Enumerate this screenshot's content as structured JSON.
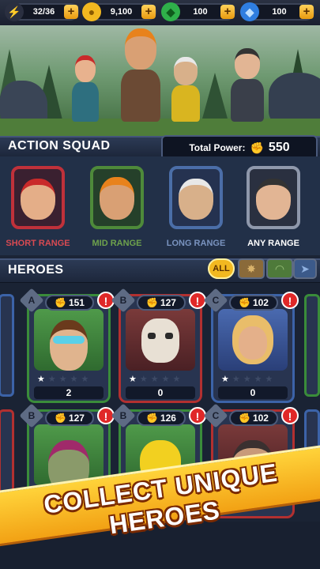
{
  "resources": [
    {
      "name": "energy",
      "value": "32/36",
      "icon": "lightning-icon",
      "color": "#f2c230"
    },
    {
      "name": "coins",
      "value": "9,100",
      "icon": "coin-icon",
      "color": "#f2b820"
    },
    {
      "name": "gems-green",
      "value": "100",
      "icon": "green-gem-icon",
      "color": "#2fb04a"
    },
    {
      "name": "diamonds",
      "value": "100",
      "icon": "blue-diamond-icon",
      "color": "#2f7ee0"
    }
  ],
  "squad": {
    "title": "ACTION SQUAD",
    "total_power_label": "Total Power:",
    "total_power_value": "550",
    "slots": [
      {
        "range": "SHORT RANGE",
        "color": "#c0313a",
        "label_color": "#d84a52"
      },
      {
        "range": "MID RANGE",
        "color": "#4e8a3a",
        "label_color": "#6ea24c"
      },
      {
        "range": "LONG RANGE",
        "color": "#4b6ea8",
        "label_color": "#7a93bf"
      },
      {
        "range": "ANY RANGE",
        "color": "#8f98ab",
        "label_color": "#ffffff"
      }
    ]
  },
  "heroes": {
    "title": "HEROES",
    "filters": [
      "ALL",
      "short",
      "mid",
      "long"
    ],
    "cards": [
      {
        "rank": "A",
        "power": "151",
        "count": "2",
        "stars": 1,
        "alert": "!",
        "color": "#3a8c3a"
      },
      {
        "rank": "B",
        "power": "127",
        "count": "0",
        "stars": 1,
        "alert": "!",
        "color": "#b23030"
      },
      {
        "rank": "C",
        "power": "102",
        "count": "0",
        "stars": 1,
        "alert": "!",
        "color": "#3c63a8"
      },
      {
        "rank": "B",
        "power": "127",
        "count": "",
        "stars": 0,
        "alert": "!",
        "color": "#3a8c3a"
      },
      {
        "rank": "B",
        "power": "126",
        "count": "",
        "stars": 0,
        "alert": "!",
        "color": "#3a8c3a"
      },
      {
        "rank": "C",
        "power": "102",
        "count": "",
        "stars": 0,
        "alert": "!",
        "color": "#b23030"
      }
    ]
  },
  "banner": {
    "text": "COLLECT UNIQUE HEROES"
  },
  "colors": {
    "accent": "#f2a114",
    "panel": "#223048"
  }
}
